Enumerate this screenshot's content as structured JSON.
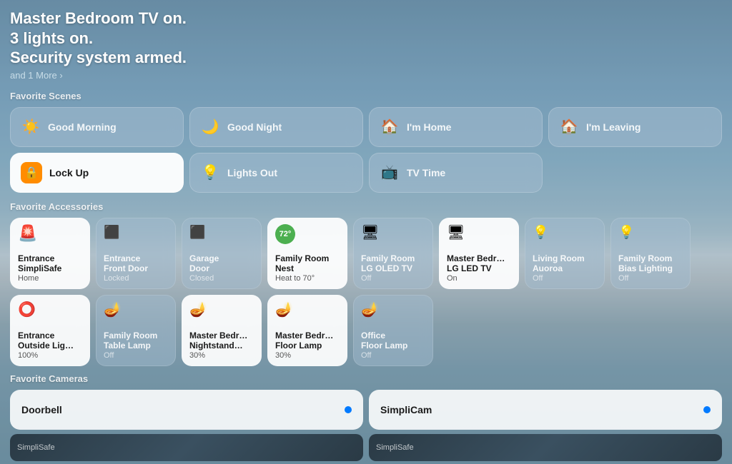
{
  "header": {
    "line1": "Master Bedroom TV on.",
    "line2": "3 lights on.",
    "line3": "Security system armed.",
    "more": "and 1 More ›"
  },
  "scenes_title": "Favorite Scenes",
  "scenes": [
    {
      "id": "good-morning",
      "label": "Good Morning",
      "icon": "☀️",
      "active": false,
      "col": 1,
      "row": 1
    },
    {
      "id": "good-night",
      "label": "Good Night",
      "icon": "🌙",
      "active": false,
      "col": 2,
      "row": 1
    },
    {
      "id": "im-home",
      "label": "I'm Home",
      "icon": "🏠",
      "active": false,
      "col": 3,
      "row": 1
    },
    {
      "id": "im-leaving",
      "label": "I'm Leaving",
      "icon": "🚶",
      "active": false,
      "col": 4,
      "row": 1
    },
    {
      "id": "lock-up",
      "label": "Lock Up",
      "icon": "🔒",
      "active": true,
      "col": 1,
      "row": 2
    },
    {
      "id": "lights-out",
      "label": "Lights Out",
      "icon": "💡",
      "active": false,
      "col": 2,
      "row": 2
    },
    {
      "id": "tv-time",
      "label": "TV Time",
      "icon": "📺",
      "active": false,
      "col": 3,
      "row": 2
    }
  ],
  "accessories_title": "Favorite Accessories",
  "accessories_row1": [
    {
      "id": "entrance-simplisafe",
      "name": "Entrance SimpliSafe",
      "status": "Home",
      "icon": "🚨",
      "active": true
    },
    {
      "id": "entrance-front-door",
      "name": "Entrance Front Door",
      "status": "Locked",
      "icon": "🚪",
      "active": false
    },
    {
      "id": "garage-door",
      "name": "Garage Door",
      "status": "Closed",
      "icon": "🚗",
      "active": false
    },
    {
      "id": "family-room-nest",
      "name": "Family Room Nest",
      "status": "Heat to 70°",
      "icon": "nest",
      "active": true,
      "badge": "72°"
    },
    {
      "id": "family-room-lg-oled",
      "name": "Family Room LG OLED TV",
      "status": "Off",
      "icon": "🖥",
      "active": false
    },
    {
      "id": "master-bedr-lg-led",
      "name": "Master Bedr… LG LED TV",
      "status": "On",
      "icon": "🖥",
      "active": true
    },
    {
      "id": "living-room-aurora",
      "name": "Living Room Auoroa",
      "status": "Off",
      "icon": "💡",
      "active": false
    },
    {
      "id": "family-room-bias",
      "name": "Family Room Bias Lighting",
      "status": "Off",
      "icon": "💡",
      "active": false
    }
  ],
  "accessories_row2": [
    {
      "id": "entrance-outside-lig",
      "name": "Entrance Outside Lig…",
      "status": "100%",
      "icon": "💡",
      "active": true
    },
    {
      "id": "family-room-table-lamp",
      "name": "Family Room Table Lamp",
      "status": "Off",
      "icon": "🪔",
      "active": false
    },
    {
      "id": "master-bedr-nightstand",
      "name": "Master Bedr… Nightstand…",
      "status": "30%",
      "icon": "🪔",
      "active": true
    },
    {
      "id": "master-bedr-floor-lamp",
      "name": "Master Bedr… Floor Lamp",
      "status": "30%",
      "icon": "🪔",
      "active": true
    },
    {
      "id": "office-floor-lamp",
      "name": "Office Floor Lamp",
      "status": "Off",
      "icon": "🪔",
      "active": false
    }
  ],
  "cameras_title": "Favorite Cameras",
  "cameras": [
    {
      "id": "doorbell",
      "name": "Doorbell",
      "dot": true
    },
    {
      "id": "simplicam",
      "name": "SimpliCam",
      "dot": true
    }
  ],
  "camera_previews": [
    {
      "id": "preview-simplisafe-1",
      "label": "SimpliSafe"
    },
    {
      "id": "preview-simplisafe-2",
      "label": "SimpliSafe"
    }
  ]
}
